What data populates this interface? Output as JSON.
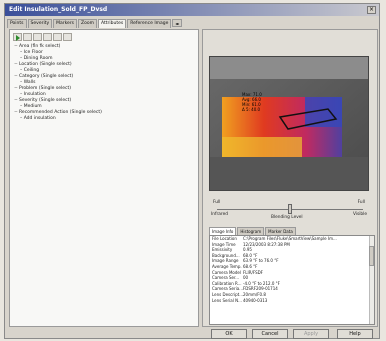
{
  "window": {
    "title": "Edit Insulation_Sold_FP_Dvsd"
  },
  "tabs": [
    {
      "label": "Points"
    },
    {
      "label": "Severity"
    },
    {
      "label": "Markers"
    },
    {
      "label": "Zoom"
    },
    {
      "label": "Attributes"
    },
    {
      "label": "Reference Image"
    }
  ],
  "active_tab_index": 4,
  "tree": [
    {
      "label": "Area (fln fk select)",
      "level": 0,
      "toggle": "−"
    },
    {
      "label": "Ice Floor",
      "level": 1
    },
    {
      "label": "Dining Room",
      "level": 1
    },
    {
      "label": "Location (Single select)",
      "level": 0,
      "toggle": "−"
    },
    {
      "label": "Ceiling",
      "level": 1
    },
    {
      "label": "Category (Single select)",
      "level": 0,
      "toggle": "−"
    },
    {
      "label": "Walls",
      "level": 1
    },
    {
      "label": "Problem (Single select)",
      "level": 0,
      "toggle": "−"
    },
    {
      "label": "Insulation",
      "level": 1
    },
    {
      "label": "Severity (Single select)",
      "level": 0,
      "toggle": "−"
    },
    {
      "label": "Medium",
      "level": 1
    },
    {
      "label": "Recommended Action (Single select)",
      "level": 0,
      "toggle": "−"
    },
    {
      "label": "Add insulation",
      "level": 1
    }
  ],
  "thermal": {
    "overlay_lines": [
      "Max: 71.0",
      "Avg: 66.0",
      "Min: 61.0",
      "Δ 5: 40.0"
    ]
  },
  "slider": {
    "left_top": "Full",
    "left_bottom": "Infrared",
    "right_top": "Full",
    "right_bottom": "Visible",
    "center": "Blending Level",
    "value": 0.5
  },
  "subtabs": [
    {
      "label": "Image Info"
    },
    {
      "label": "Histogram"
    },
    {
      "label": "Marker Data"
    }
  ],
  "info_rows": [
    {
      "k": "File Location",
      "v": "C:\\Program Files\\Fluke\\SmartView\\Sample Im..."
    },
    {
      "k": "Image Time",
      "v": "12/23/2003 8:27:38 PM"
    },
    {
      "k": "Emissivity",
      "v": "0.95"
    },
    {
      "k": "Background...",
      "v": "68.0 °F"
    },
    {
      "k": "Image Range",
      "v": "63.9 °F to 76.0 °F"
    },
    {
      "k": "Average Temp.",
      "v": "68.6 °F"
    },
    {
      "k": "Camera Model",
      "v": "FLIR/FSDF"
    },
    {
      "k": "Camera Ser...",
      "v": "00"
    },
    {
      "k": "Calibration R...",
      "v": "-4.0 °F to 212.0 °F"
    },
    {
      "k": "Camera Seria...",
      "v": "FDSRF209-01714"
    },
    {
      "k": "Lens Descript...",
      "v": "20mm/F0.8"
    },
    {
      "k": "Lens Serial N...",
      "v": "40940-0313"
    }
  ],
  "buttons": {
    "ok": "OK",
    "cancel": "Cancel",
    "apply": "Apply",
    "help": "Help"
  }
}
